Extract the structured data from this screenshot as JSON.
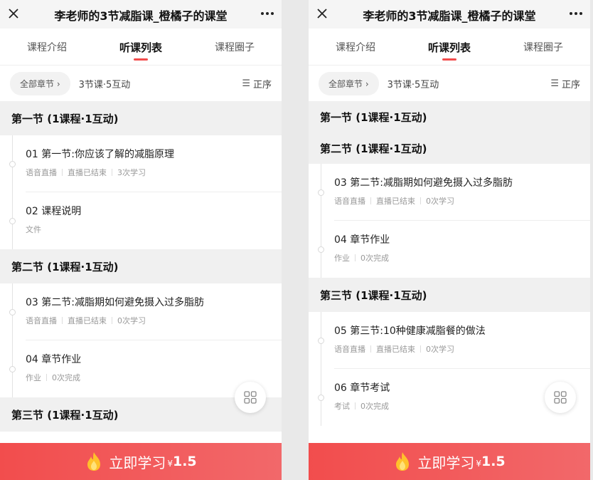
{
  "screens": [
    {
      "title": "李老师的3节减脂课_橙橘子的课堂",
      "tabs": [
        "课程介绍",
        "听课列表",
        "课程圈子"
      ],
      "filter": {
        "chapter": "全部章节 ›",
        "count": "3节课·5互动",
        "sort": "正序"
      },
      "list": [
        {
          "type": "section",
          "label": "第一节 (1课程·1互动)"
        },
        {
          "type": "item",
          "title": "01 第一节:你应该了解的减脂原理",
          "meta": [
            "语音直播",
            "直播已结束",
            "3次学习"
          ]
        },
        {
          "type": "item",
          "title": "02 课程说明",
          "meta": [
            "文件"
          ]
        },
        {
          "type": "section",
          "label": "第二节 (1课程·1互动)"
        },
        {
          "type": "item",
          "title": "03 第二节:减脂期如何避免摄入过多脂肪",
          "meta": [
            "语音直播",
            "直播已结束",
            "0次学习"
          ]
        },
        {
          "type": "item",
          "title": "04 章节作业",
          "meta": [
            "作业",
            "0次完成"
          ]
        },
        {
          "type": "section",
          "label": "第三节 (1课程·1互动)"
        }
      ],
      "cta": {
        "label": "立即学习",
        "currency": "¥",
        "price": "1.5"
      }
    },
    {
      "title": "李老师的3节减脂课_橙橘子的课堂",
      "tabs": [
        "课程介绍",
        "听课列表",
        "课程圈子"
      ],
      "filter": {
        "chapter": "全部章节 ›",
        "count": "3节课·5互动",
        "sort": "正序"
      },
      "list": [
        {
          "type": "section",
          "label": "第一节 (1课程·1互动)"
        },
        {
          "type": "section",
          "label": "第二节 (1课程·1互动)"
        },
        {
          "type": "item",
          "title": "03 第二节:减脂期如何避免摄入过多脂肪",
          "meta": [
            "语音直播",
            "直播已结束",
            "0次学习"
          ]
        },
        {
          "type": "item",
          "title": "04 章节作业",
          "meta": [
            "作业",
            "0次完成"
          ]
        },
        {
          "type": "section",
          "label": "第三节 (1课程·1互动)"
        },
        {
          "type": "item",
          "title": "05 第三节:10种健康减脂餐的做法",
          "meta": [
            "语音直播",
            "直播已结束",
            "0次学习"
          ]
        },
        {
          "type": "item",
          "title": "06 章节考试",
          "meta": [
            "考试",
            "0次完成"
          ]
        }
      ],
      "cta": {
        "label": "立即学习",
        "currency": "¥",
        "price": "1.5"
      }
    }
  ],
  "icons": {
    "close": "close-icon",
    "more": "more-icon",
    "sort": "sort-icon",
    "grid": "grid-icon",
    "fire": "fire-icon"
  },
  "colors": {
    "accent": "#f24b4b",
    "section_bg": "#f0f0f0",
    "muted_text": "#999999"
  }
}
